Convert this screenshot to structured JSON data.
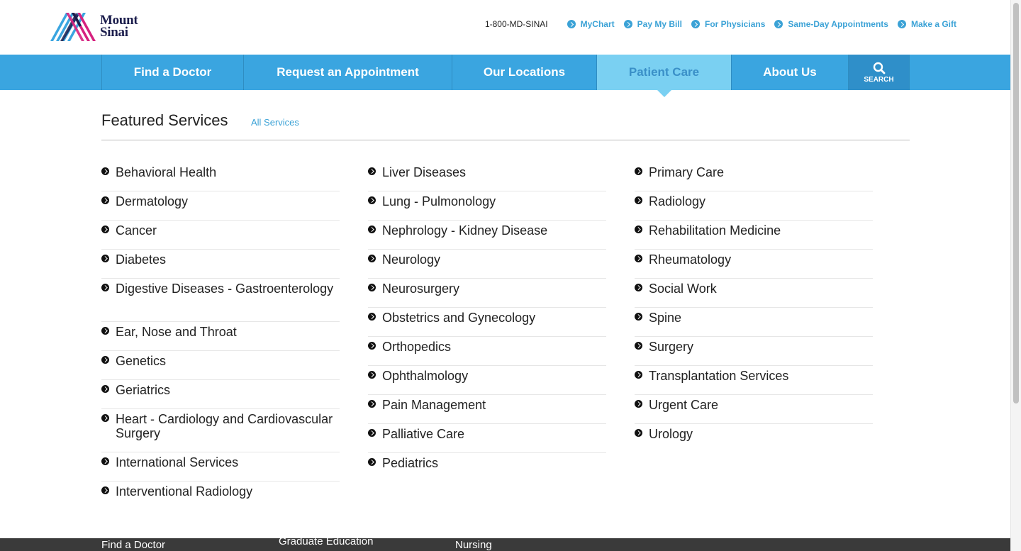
{
  "brand": {
    "line1": "Mount",
    "line2": "Sinai",
    "colors": {
      "blue": "#3aa5e0",
      "navy": "#1b1d4c",
      "magenta": "#d6217f"
    }
  },
  "utility": {
    "phone": "1-800-MD-SINAI",
    "links": [
      "MyChart",
      "Pay My Bill",
      "For Physicians",
      "Same-Day Appointments",
      "Make a Gift"
    ]
  },
  "nav": {
    "items": [
      "Find a Doctor",
      "Request an Appointment",
      "Our Locations",
      "Patient Care",
      "About Us"
    ],
    "active": "Patient Care",
    "search_label": "SEARCH"
  },
  "featured": {
    "title": "Featured Services",
    "all_services": "All Services",
    "col1": [
      "Behavioral Health",
      "Dermatology",
      "Cancer",
      "Diabetes",
      "Digestive Diseases - Gastroenterology",
      "Ear, Nose and Throat",
      "Genetics",
      "Geriatrics",
      "Heart - Cardiology and Cardiovascular Surgery",
      "International Services",
      "Interventional Radiology"
    ],
    "col2": [
      "Liver Diseases",
      "Lung - Pulmonology",
      "Nephrology - Kidney Disease",
      "Neurology",
      "Neurosurgery",
      "Obstetrics and Gynecology",
      "Orthopedics",
      "Ophthalmology",
      "Pain Management",
      "Palliative Care",
      "Pediatrics"
    ],
    "col3": [
      "Primary Care",
      "Radiology",
      "Rehabilitation Medicine",
      "Rheumatology",
      "Social Work",
      "Spine",
      "Surgery",
      "Transplantation Services",
      "Urgent Care",
      "Urology"
    ]
  },
  "footer": {
    "links": [
      "Find a Doctor",
      "Graduate Education",
      "Nursing"
    ]
  }
}
